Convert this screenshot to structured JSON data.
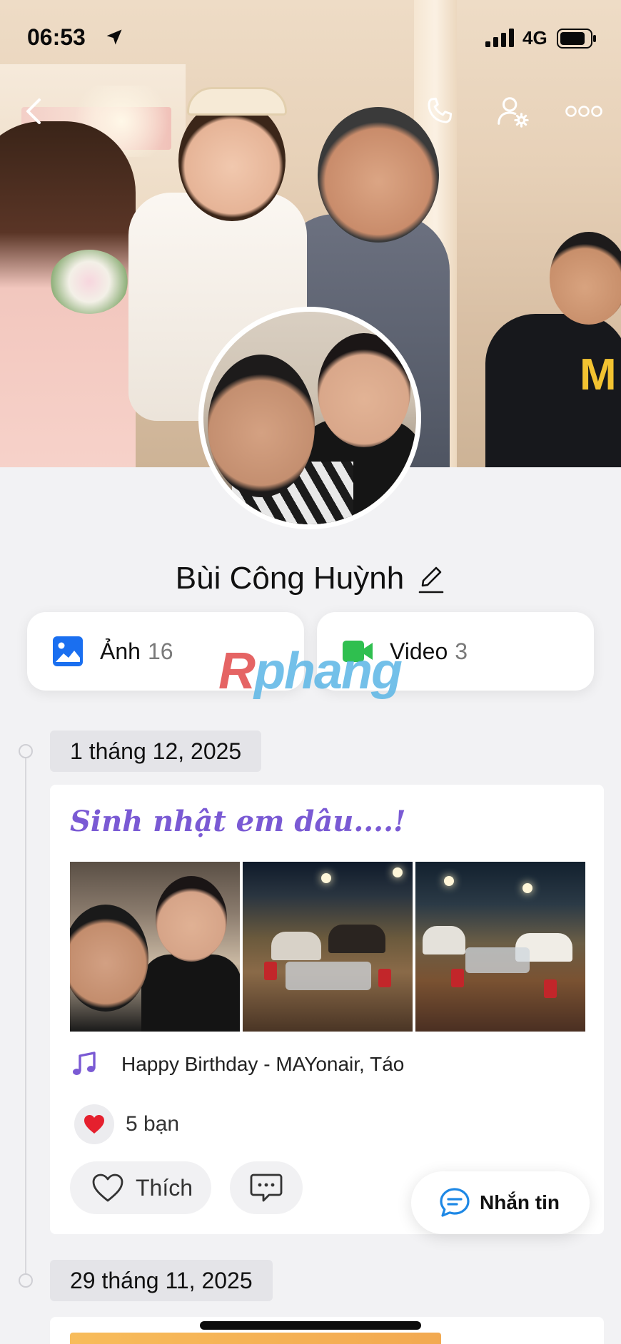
{
  "status_bar": {
    "time": "06:53",
    "network": "4G"
  },
  "profile": {
    "name": "Bùi Công Huỳnh"
  },
  "media": {
    "photos": {
      "label": "Ảnh",
      "count": "16"
    },
    "videos": {
      "label": "Video",
      "count": "3"
    }
  },
  "watermark": {
    "prefix": "R",
    "rest": "phang"
  },
  "timeline": [
    {
      "date": "1 tháng 12, 2025",
      "title": "Sinh nhật em dâu....!",
      "music": "Happy Birthday - MAYonair, Táo",
      "reactions": "5 bạn",
      "like_label": "Thích"
    },
    {
      "date": "29 tháng 11, 2025"
    }
  ],
  "message_button": {
    "label": "Nhắn tin"
  },
  "colors": {
    "accent": "#7a5ad4",
    "photo_icon": "#1a6ff0",
    "video_icon": "#2fbf4f",
    "message_icon": "#1e88e5"
  }
}
